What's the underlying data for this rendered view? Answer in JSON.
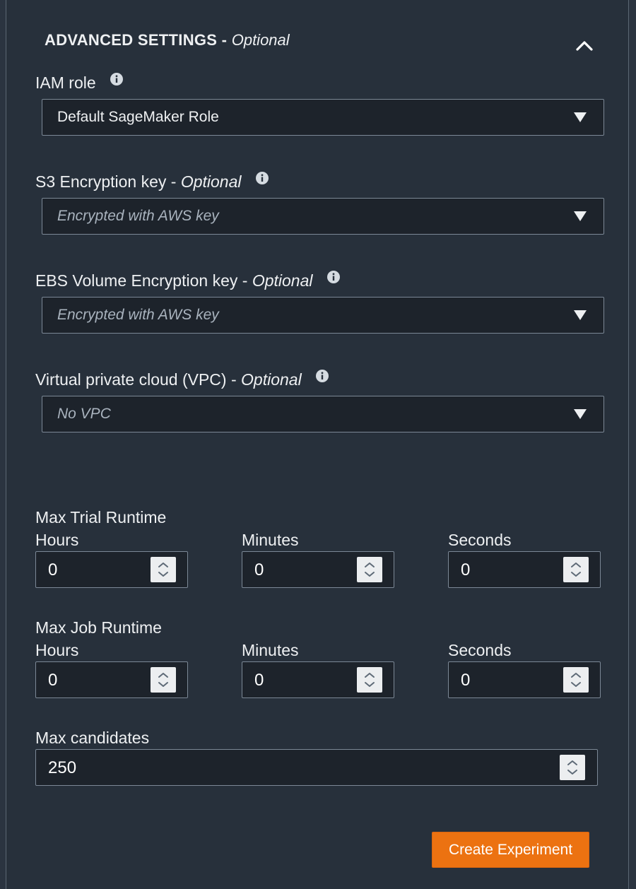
{
  "section": {
    "title": "ADVANCED SETTINGS - ",
    "optional": "Optional"
  },
  "iam_role": {
    "label": "IAM role",
    "value": "Default SageMaker Role"
  },
  "s3_key": {
    "label": "S3 Encryption key - ",
    "optional": "Optional",
    "placeholder": "Encrypted with AWS key"
  },
  "ebs_key": {
    "label": "EBS Volume Encryption key - ",
    "optional": "Optional",
    "placeholder": "Encrypted with AWS key"
  },
  "vpc": {
    "label": "Virtual private cloud (VPC) - ",
    "optional": "Optional",
    "placeholder": "No VPC"
  },
  "max_trial_runtime": {
    "title": "Max Trial Runtime",
    "hours_label": "Hours",
    "minutes_label": "Minutes",
    "seconds_label": "Seconds",
    "hours": "0",
    "minutes": "0",
    "seconds": "0"
  },
  "max_job_runtime": {
    "title": "Max Job Runtime",
    "hours_label": "Hours",
    "minutes_label": "Minutes",
    "seconds_label": "Seconds",
    "hours": "0",
    "minutes": "0",
    "seconds": "0"
  },
  "max_candidates": {
    "label": "Max candidates",
    "value": "250"
  },
  "actions": {
    "create_label": "Create Experiment"
  },
  "colors": {
    "background": "#27303b",
    "input_background": "#1d232b",
    "primary_button": "#ec7211"
  },
  "icons": {
    "collapse": "chevron-up-icon",
    "info": "info-icon",
    "dropdown": "caret-down-icon",
    "spinner": "spinner-up-down-icon"
  }
}
